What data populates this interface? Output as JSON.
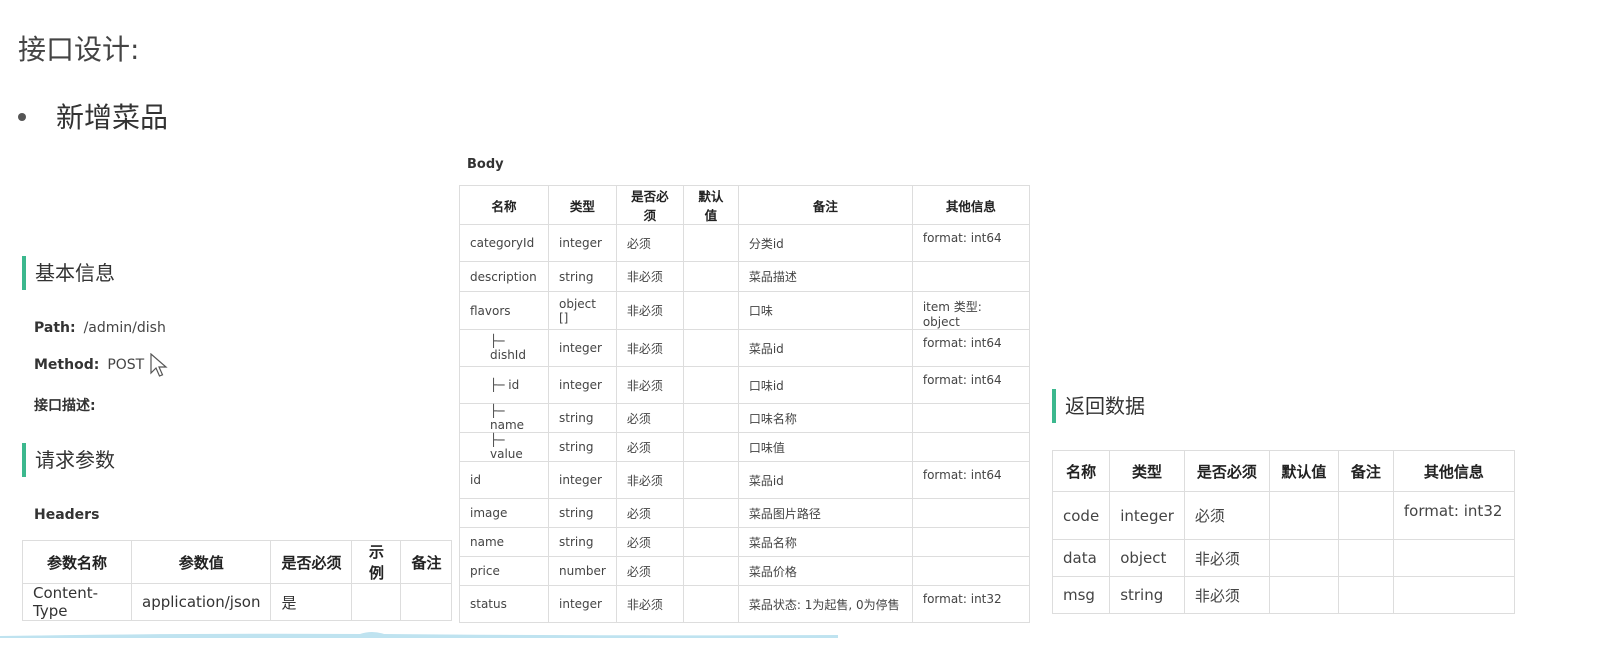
{
  "title": "接口设计:",
  "bullet": "新增菜品",
  "basic": {
    "section_title": "基本信息",
    "path_label": "Path:",
    "path_value": "/admin/dish",
    "method_label": "Method:",
    "method_value": "POST",
    "desc_label": "接口描述:"
  },
  "request": {
    "section_title": "请求参数",
    "headers_label": "Headers",
    "headers_columns": [
      "参数名称",
      "参数值",
      "是否必须",
      "示例",
      "备注"
    ],
    "headers_rows": [
      [
        "Content-Type",
        "application/json",
        "是",
        "",
        ""
      ]
    ]
  },
  "body": {
    "label": "Body",
    "columns": [
      "名称",
      "类型",
      "是否必须",
      "默认值",
      "备注",
      "其他信息"
    ],
    "rows": [
      [
        "categoryId",
        "integer",
        "必须",
        "",
        "分类id",
        "format: int64"
      ],
      [
        "description",
        "string",
        "非必须",
        "",
        "菜品描述",
        ""
      ],
      [
        "flavors",
        "object []",
        "非必须",
        "",
        "口味",
        "item 类型: object"
      ],
      [
        "├─ dishId",
        "integer",
        "非必须",
        "",
        "菜品id",
        "format: int64"
      ],
      [
        "├─ id",
        "integer",
        "非必须",
        "",
        "口味id",
        "format: int64"
      ],
      [
        "├─ name",
        "string",
        "必须",
        "",
        "口味名称",
        ""
      ],
      [
        "├─ value",
        "string",
        "必须",
        "",
        "口味值",
        ""
      ],
      [
        "id",
        "integer",
        "非必须",
        "",
        "菜品id",
        "format: int64"
      ],
      [
        "image",
        "string",
        "必须",
        "",
        "菜品图片路径",
        ""
      ],
      [
        "name",
        "string",
        "必须",
        "",
        "菜品名称",
        ""
      ],
      [
        "price",
        "number",
        "必须",
        "",
        "菜品价格",
        ""
      ],
      [
        "status",
        "integer",
        "非必须",
        "",
        "菜品状态: 1为起售, 0为停售",
        "format: int32"
      ]
    ]
  },
  "response": {
    "section_title": "返回数据",
    "columns": [
      "名称",
      "类型",
      "是否必须",
      "默认值",
      "备注",
      "其他信息"
    ],
    "rows": [
      [
        "code",
        "integer",
        "必须",
        "",
        "",
        "format: int32"
      ],
      [
        "data",
        "object",
        "非必须",
        "",
        "",
        ""
      ],
      [
        "msg",
        "string",
        "非必须",
        "",
        "",
        ""
      ]
    ]
  },
  "colors": {
    "accent_bar": "#3cb88e",
    "border": "#dddddd",
    "wave": "#bfe3f0"
  },
  "icons": [
    "mouse-cursor-icon"
  ]
}
